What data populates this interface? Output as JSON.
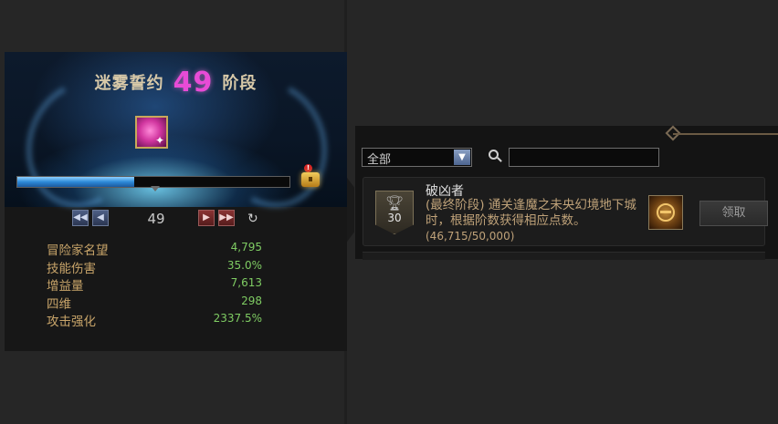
{
  "pact": {
    "title": "迷雾誓约",
    "stage": "49",
    "stage_suffix": "阶段",
    "progress_fraction": 0.43,
    "current_level": "49"
  },
  "stats": [
    {
      "label": "冒险家名望",
      "value": "4,795"
    },
    {
      "label": "技能伤害",
      "value": "35.0%"
    },
    {
      "label": "增益量",
      "value": "7,613"
    },
    {
      "label": "四维",
      "value": "298"
    },
    {
      "label": "攻击强化",
      "value": "2337.5%"
    }
  ],
  "filter": {
    "selected": "全部"
  },
  "achievement": {
    "points": "30",
    "title": "破凶者",
    "description": "(最终阶段) 通关逢魔之未央幻境地下城时，根据阶数获得相应点数。",
    "progress": "(46,715/50,000)",
    "claim_label": "领取"
  },
  "colors": {
    "stage_accent": "#e84bd6",
    "stat_label": "#c9a56a",
    "stat_value": "#7fcc63",
    "progress_fill": "#2d8ad8"
  },
  "icons": {
    "pact": "pink-crystal-icon",
    "chest": "treasure-chest-icon",
    "trophy": "trophy-icon",
    "reward": "emblem-icon",
    "search": "search-icon"
  }
}
